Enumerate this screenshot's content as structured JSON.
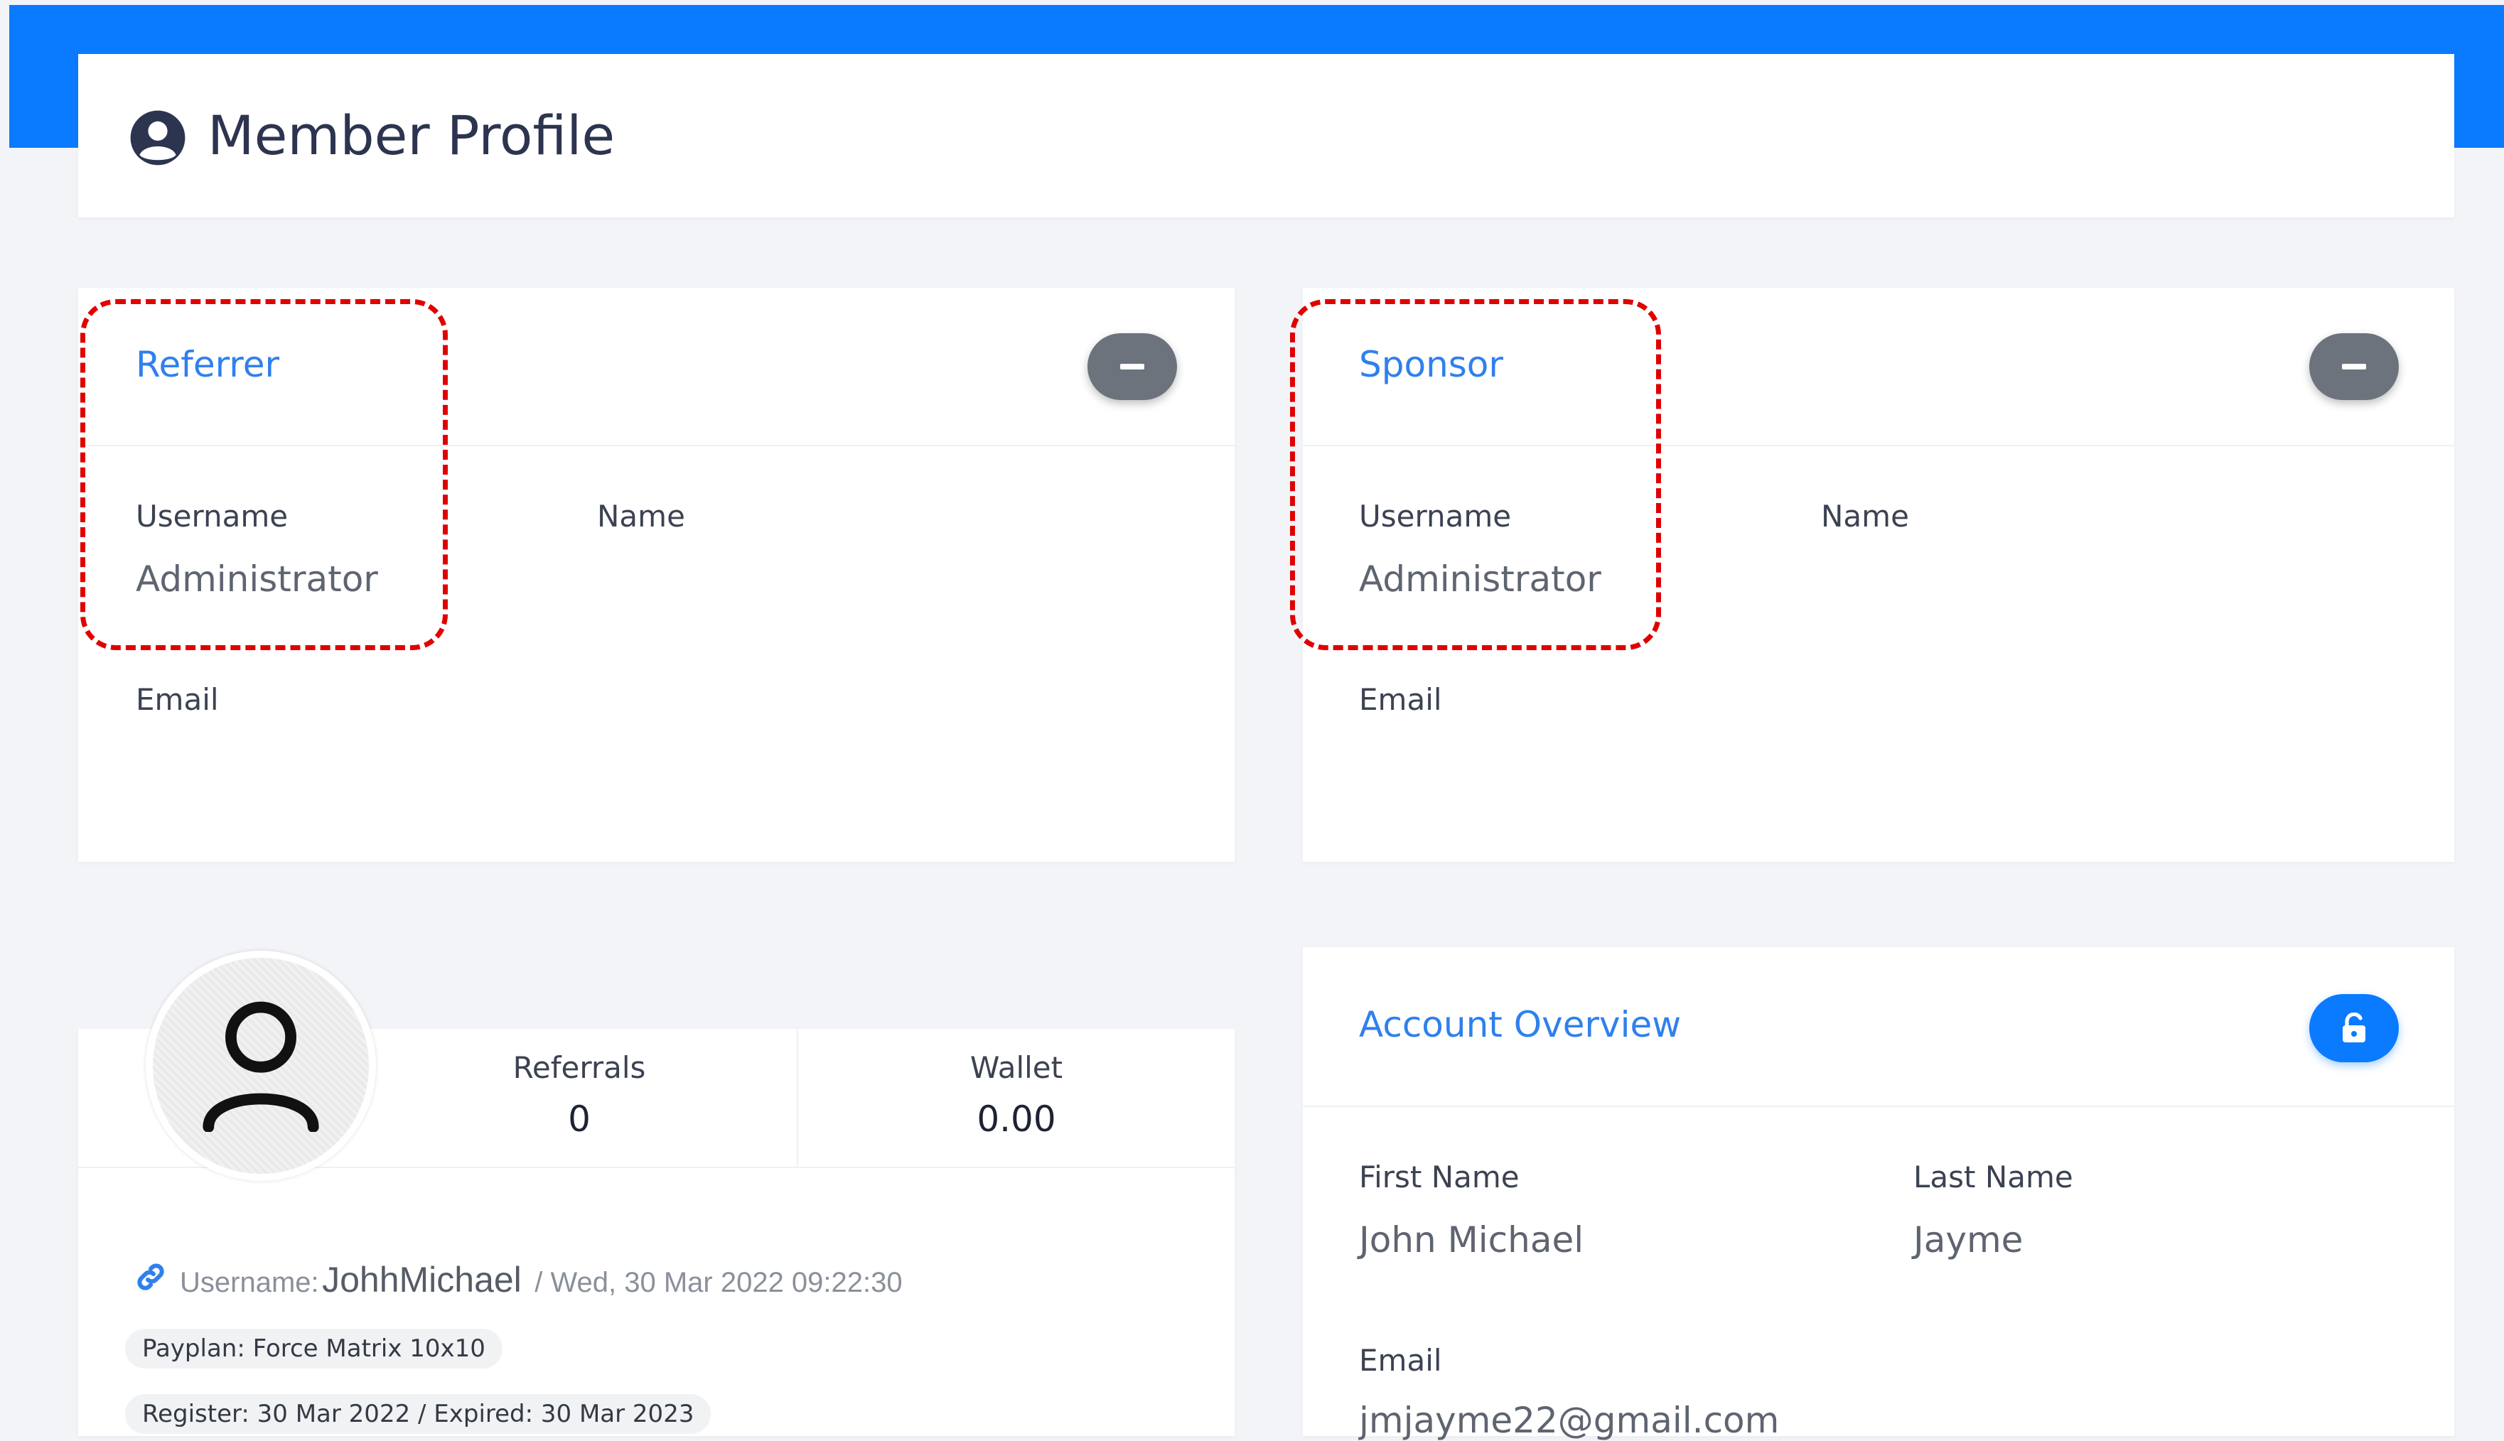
{
  "page": {
    "title": "Member Profile"
  },
  "referrer": {
    "title": "Referrer",
    "username_label": "Username",
    "username_value": "Administrator",
    "name_label": "Name",
    "email_label": "Email"
  },
  "sponsor": {
    "title": "Sponsor",
    "username_label": "Username",
    "username_value": "Administrator",
    "name_label": "Name",
    "email_label": "Email"
  },
  "profile": {
    "referrals_label": "Referrals",
    "referrals_value": "0",
    "wallet_label": "Wallet",
    "wallet_value": "0.00",
    "username_prefix": "Username:",
    "username": "JohhMichael",
    "join_date": "/ Wed, 30 Mar 2022 09:22:30",
    "payplan": "Payplan: Force Matrix 10x10",
    "register": "Register: 30 Mar 2022 / Expired: 30 Mar 2023"
  },
  "account_overview": {
    "title": "Account Overview",
    "first_name_label": "First Name",
    "first_name_value": "John Michael",
    "last_name_label": "Last Name",
    "last_name_value": "Jayme",
    "email_label": "Email",
    "email_value": "jmjayme22@gmail.com"
  },
  "colors": {
    "accent": "#0a7bff",
    "highlight": "#e00000"
  },
  "icons": [
    "user-circle-icon",
    "minus-icon",
    "user-icon",
    "link-icon",
    "unlock-icon"
  ]
}
